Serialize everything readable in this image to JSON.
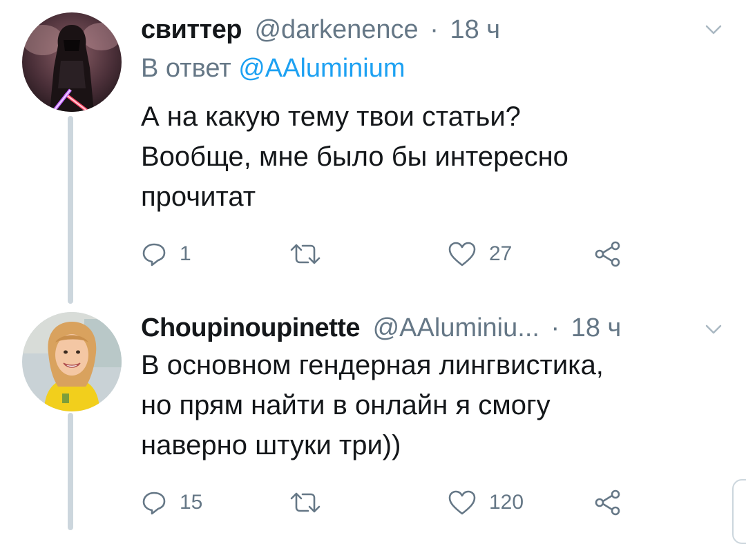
{
  "tweets": [
    {
      "display_name": "свиттер",
      "handle": "@darkenence",
      "separator": "·",
      "time": "18 ч",
      "reply_prefix": "В ответ",
      "reply_to": "@AAluminium",
      "text_lines": [
        "А на какую тему твои статьи?",
        "Вообще, мне было бы интересно",
        "прочитат"
      ],
      "replies": "1",
      "retweets": "",
      "likes": "27",
      "avatar": "dark-hooded-figure-with-lightsaber"
    },
    {
      "display_name": "Choupinoupinette",
      "handle": "@AAluminiu...",
      "separator": "·",
      "time": "18 ч",
      "text_lines": [
        "В основном гендерная лингвистика,",
        "но прям найти в онлайн я смогу",
        "наверно штуки три))"
      ],
      "replies": "15",
      "retweets": "",
      "likes": "120",
      "avatar": "smiling-woman-yellow-shirt"
    }
  ],
  "icons": {
    "reply": "reply-icon",
    "retweet": "retweet-icon",
    "like": "heart-icon",
    "share": "share-icon",
    "menu": "chevron-down-icon"
  },
  "colors": {
    "link": "#1da1f2",
    "secondary": "#657786",
    "thread_line": "#ccd6dd"
  }
}
